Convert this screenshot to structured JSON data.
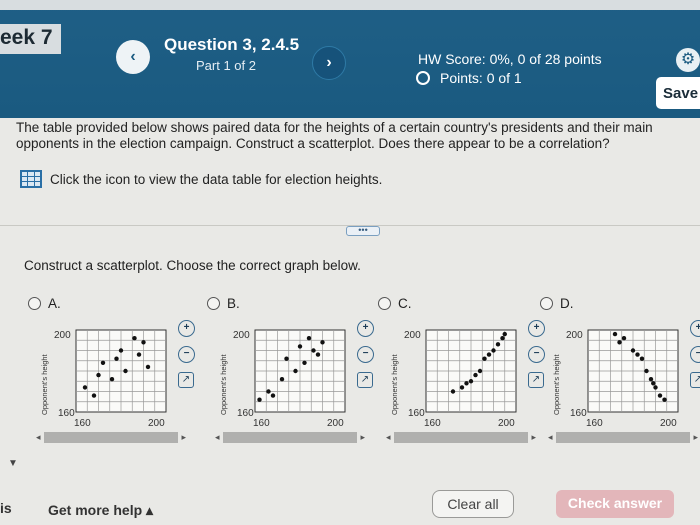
{
  "header": {
    "week_label": "eek 7",
    "question_title": "Question 3, 2.4.5",
    "question_part": "Part 1 of 2",
    "hw_score": "HW Score: 0%, 0 of 28 points",
    "points": "Points: 0 of 1",
    "save_label": "Save"
  },
  "question": {
    "text": "The table provided below shows paired data for the heights of a certain country's presidents and their main opponents in the election campaign. Construct a scatterplot. Does there appear to be a correlation?",
    "table_link": "Click the icon to view the data table for election heights.",
    "more_label": "•••",
    "instruction": "Construct a scatterplot. Choose the correct graph below."
  },
  "options": [
    {
      "letter": "A.",
      "ylabel": "Opponent's height",
      "ytick": "200",
      "ybottom": "160",
      "xleft": "160",
      "xright": "200"
    },
    {
      "letter": "B.",
      "ylabel": "Opponent's height",
      "ytick": "200",
      "ybottom": "160",
      "xleft": "160",
      "xright": "200"
    },
    {
      "letter": "C.",
      "ylabel": "Opponent's height",
      "ytick": "200",
      "ybottom": "160",
      "xleft": "160",
      "xright": "200"
    },
    {
      "letter": "D.",
      "ylabel": "Opponent's height",
      "ytick": "200",
      "ybottom": "160",
      "xleft": "160",
      "xright": "200"
    }
  ],
  "chart_data": [
    {
      "type": "scatter",
      "ylabel": "Opponent's height",
      "xlim": [
        160,
        200
      ],
      "ylim": [
        160,
        200
      ],
      "x": [
        164,
        168,
        170,
        172,
        176,
        178,
        180,
        182,
        186,
        188,
        190,
        192
      ],
      "y": [
        172,
        168,
        178,
        184,
        176,
        186,
        190,
        180,
        196,
        188,
        194,
        182
      ]
    },
    {
      "type": "scatter",
      "ylabel": "Opponent's height",
      "xlim": [
        160,
        200
      ],
      "ylim": [
        160,
        200
      ],
      "x": [
        162,
        166,
        168,
        172,
        174,
        178,
        180,
        182,
        184,
        186,
        188,
        190
      ],
      "y": [
        166,
        170,
        168,
        176,
        186,
        180,
        192,
        184,
        196,
        190,
        188,
        194
      ]
    },
    {
      "type": "scatter",
      "ylabel": "Opponent's height",
      "xlim": [
        160,
        200
      ],
      "ylim": [
        160,
        200
      ],
      "x": [
        172,
        176,
        178,
        180,
        182,
        184,
        186,
        188,
        190,
        192,
        194,
        195
      ],
      "y": [
        170,
        172,
        174,
        175,
        178,
        180,
        186,
        188,
        190,
        193,
        196,
        198
      ]
    },
    {
      "type": "scatter",
      "ylabel": "Opponent's height",
      "xlim": [
        160,
        200
      ],
      "ylim": [
        160,
        200
      ],
      "x": [
        172,
        174,
        176,
        180,
        182,
        184,
        186,
        188,
        189,
        190,
        192,
        194
      ],
      "y": [
        198,
        194,
        196,
        190,
        188,
        186,
        180,
        176,
        174,
        172,
        168,
        166
      ]
    }
  ],
  "footer": {
    "left_label": "is",
    "get_help": "Get more help ▴",
    "clear_all": "Clear all",
    "check_answer": "Check answer"
  },
  "colors": {
    "header": "#1a5a80",
    "check_answer": "#e3b6ba"
  }
}
